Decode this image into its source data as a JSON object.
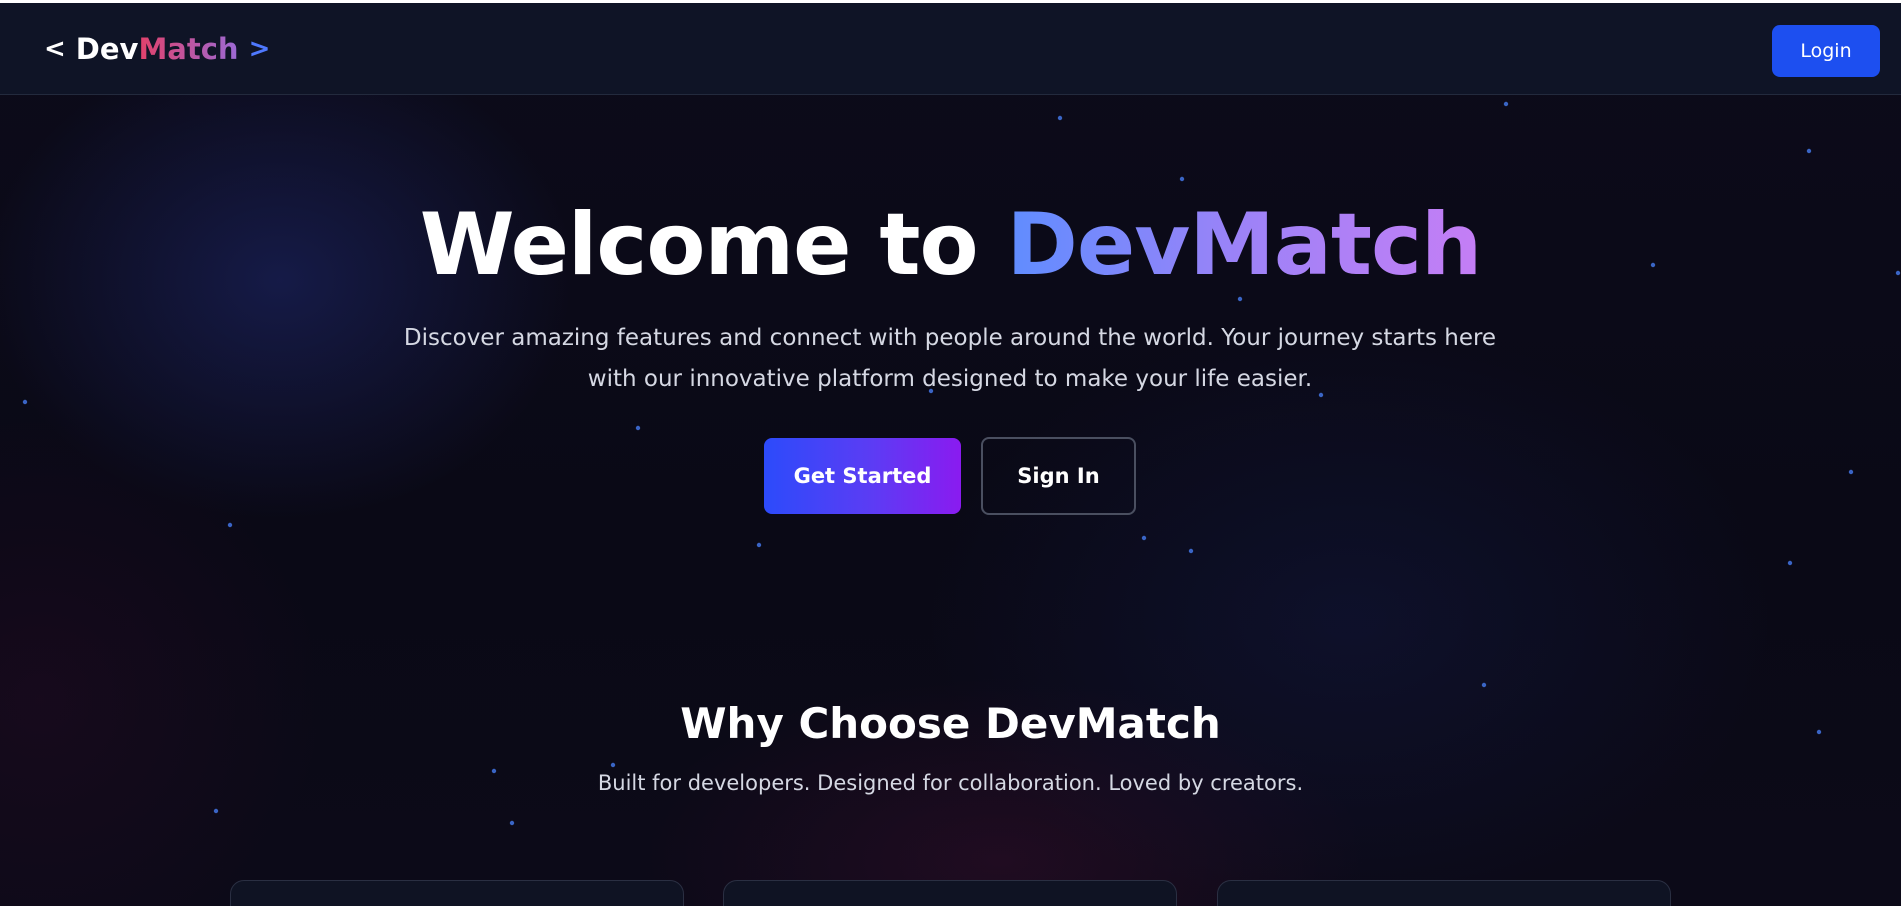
{
  "nav": {
    "logo": {
      "left_glyph": "<",
      "dev": "Dev",
      "match": "Match",
      "right_glyph": ">"
    },
    "login_label": "Login"
  },
  "hero": {
    "title_plain": "Welcome to",
    "title_highlight": "DevMatch",
    "subtitle": "Discover amazing features and connect with people around the world. Your journey starts here with our innovative platform designed to make your life easier.",
    "primary_button": "Get Started",
    "secondary_button": "Sign In"
  },
  "features": {
    "title": "Why Choose DevMatch",
    "subtitle": "Built for developers. Designed for collaboration. Loved by creators."
  },
  "colors": {
    "background": "#0b0a17",
    "navbar": "#0f1426",
    "login_button": "#1d4ff0",
    "accent_blue": "#5f8dff",
    "accent_purple": "#c57ef5",
    "star": "#3f6fd8"
  },
  "icons": [
    "chevron-left-icon",
    "chevron-right-icon"
  ]
}
